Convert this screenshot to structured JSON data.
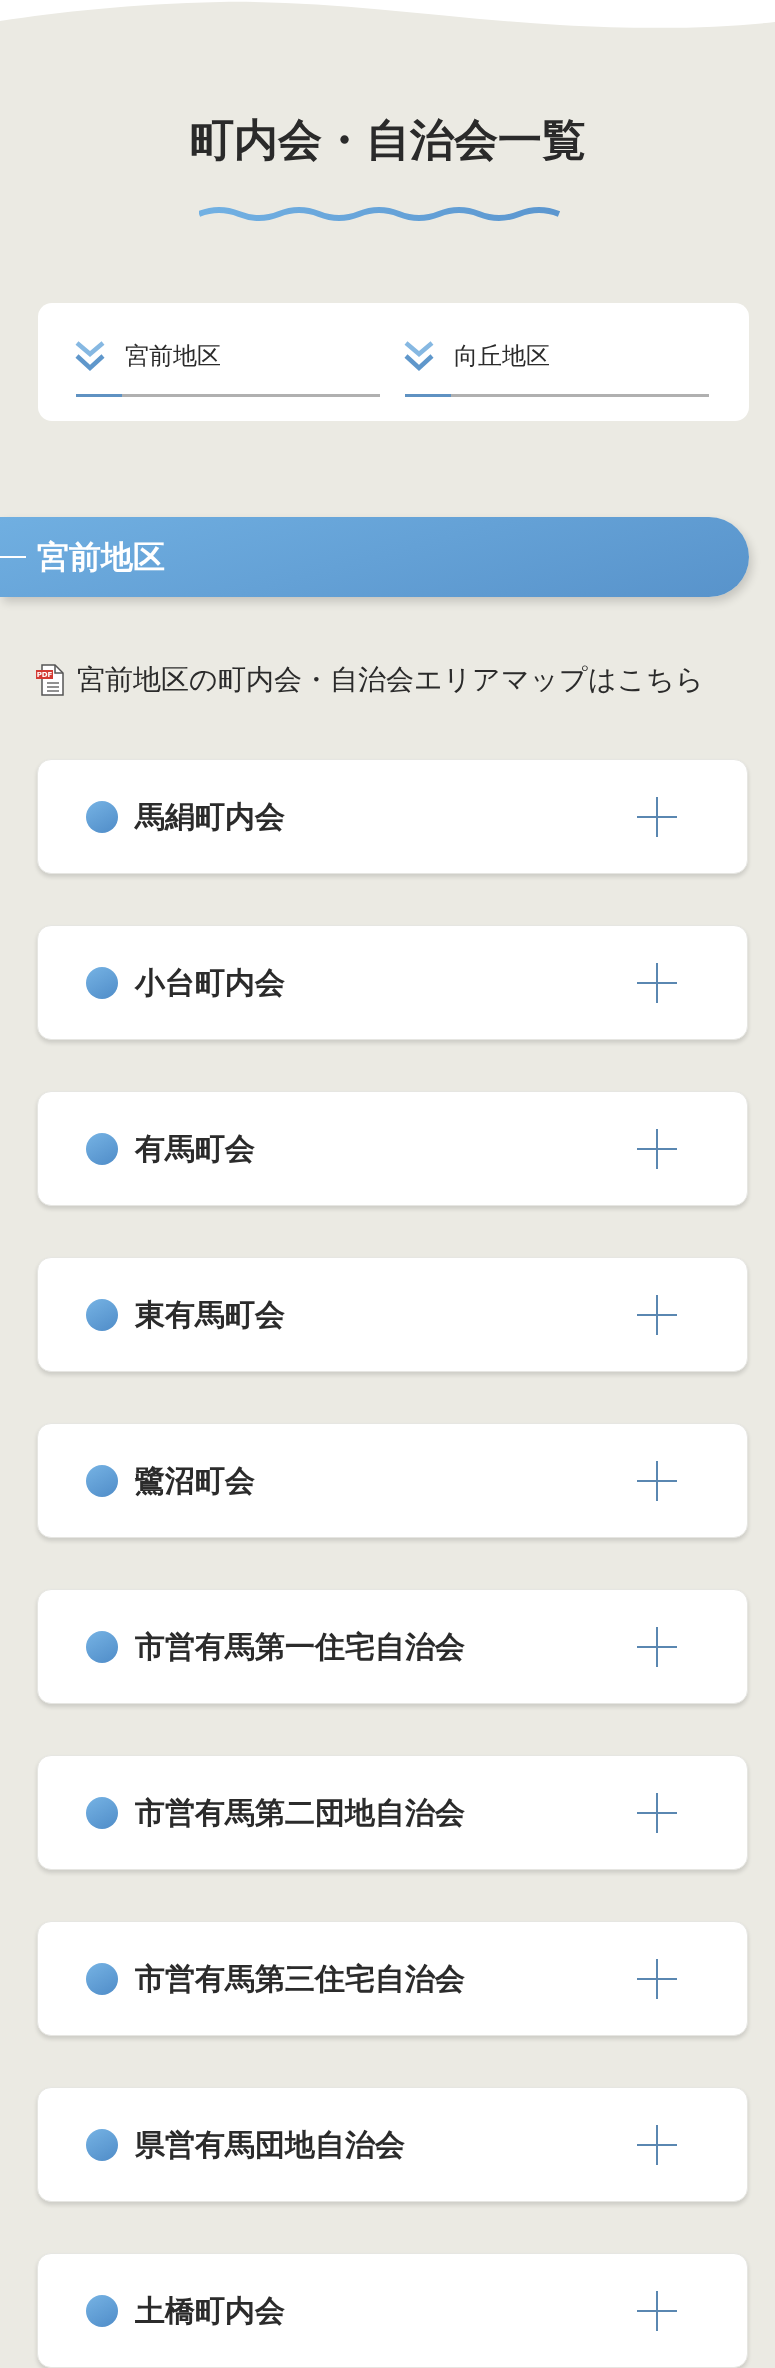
{
  "header": {
    "title": "町内会・自治会一覧"
  },
  "district_tabs": [
    {
      "label": "宮前地区"
    },
    {
      "label": "向丘地区"
    }
  ],
  "section": {
    "title": "宮前地区",
    "pdf_link": {
      "icon_label": "PDF",
      "text": "宮前地区の町内会・自治会エリアマップはこちら"
    },
    "items": [
      {
        "name": "馬絹町内会",
        "expanded": false
      },
      {
        "name": "小台町内会",
        "expanded": false
      },
      {
        "name": "有馬町会",
        "expanded": false
      },
      {
        "name": "東有馬町会",
        "expanded": false
      },
      {
        "name": "鷺沼町会",
        "expanded": false
      },
      {
        "name": "市営有馬第一住宅自治会",
        "expanded": false
      },
      {
        "name": "市営有馬第二団地自治会",
        "expanded": false
      },
      {
        "name": "市営有馬第三住宅自治会",
        "expanded": false
      },
      {
        "name": "県営有馬団地自治会",
        "expanded": false
      },
      {
        "name": "土橋町内会",
        "expanded": false
      }
    ]
  }
}
